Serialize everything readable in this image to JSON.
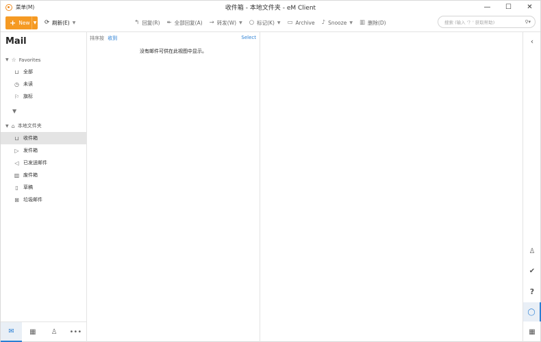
{
  "window": {
    "menu_label": "菜单(M)",
    "title": "收件箱 - 本地文件夹 - eM Client",
    "minimize_glyph": "—",
    "maximize_glyph": "☐",
    "close_glyph": "✕"
  },
  "toolbar": {
    "new_label": "New",
    "refresh_label": "刷新(E)",
    "reply_label": "回复(R)",
    "reply_all_label": "全部回复(A)",
    "forward_label": "转发(W)",
    "tag_label": "标记(K)",
    "archive_label": "Archive",
    "snooze_label": "Snooze",
    "delete_label": "删除(D)"
  },
  "search": {
    "placeholder": "搜索 (输入 '？' 获取帮助)"
  },
  "sidebar": {
    "title": "Mail",
    "favorites_label": "Favorites",
    "favorites": [
      {
        "label": "全部",
        "icon": "inbox-icon"
      },
      {
        "label": "未读",
        "icon": "clock-icon"
      },
      {
        "label": "旗标",
        "icon": "flag-icon"
      }
    ],
    "local_folders_label": "本地文件夹",
    "folders": [
      {
        "label": "收件箱",
        "icon": "inbox-icon",
        "selected": true
      },
      {
        "label": "发件箱",
        "icon": "outbox-icon"
      },
      {
        "label": "已发送邮件",
        "icon": "sent-icon"
      },
      {
        "label": "废件箱",
        "icon": "trash-icon"
      },
      {
        "label": "草稿",
        "icon": "draft-icon"
      },
      {
        "label": "垃圾邮件",
        "icon": "junk-icon"
      }
    ]
  },
  "message_list": {
    "sort_label": "排序按",
    "sort_value": "收到",
    "select_label": "Select",
    "empty_text": "没有邮件可供在此视图中显示。"
  },
  "colors": {
    "accent": "#f59a23",
    "link": "#2a7fd4",
    "selected_bg": "#e4e4e4"
  }
}
